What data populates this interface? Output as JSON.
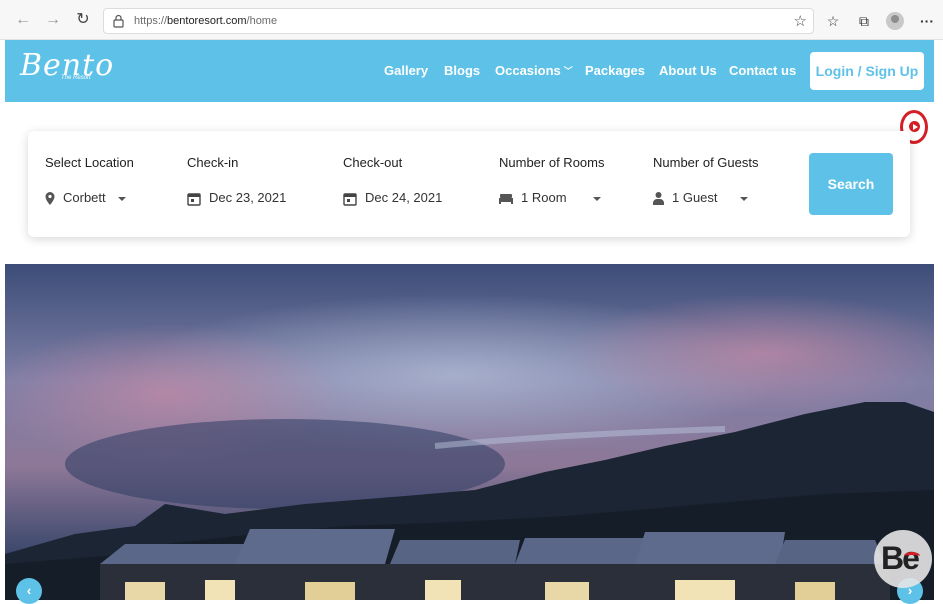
{
  "browser": {
    "url_prefix": "https://",
    "url_domain": "bentoresort.com",
    "url_path": "/home"
  },
  "header": {
    "logo": "Bento",
    "logo_sub": "The Resort",
    "menu": [
      {
        "label": "Gallery"
      },
      {
        "label": "Blogs"
      },
      {
        "label": "Occasions"
      },
      {
        "label": "Packages"
      },
      {
        "label": "About Us"
      },
      {
        "label": "Contact us"
      }
    ],
    "login_label": "Login / Sign Up",
    "brand_color": "#5ec2e8"
  },
  "search": {
    "location": {
      "label": "Select Location",
      "value": "Corbett"
    },
    "checkin": {
      "label": "Check-in",
      "value": "Dec 23, 2021"
    },
    "checkout": {
      "label": "Check-out",
      "value": "Dec 24, 2021"
    },
    "rooms": {
      "label": "Number of Rooms",
      "value": "1 Room"
    },
    "guests": {
      "label": "Number of Guests",
      "value": "1 Guest"
    },
    "button_label": "Search"
  },
  "hero": {
    "prev_icon": "‹",
    "next_icon": "›"
  },
  "watermark": {
    "text": "Be"
  }
}
